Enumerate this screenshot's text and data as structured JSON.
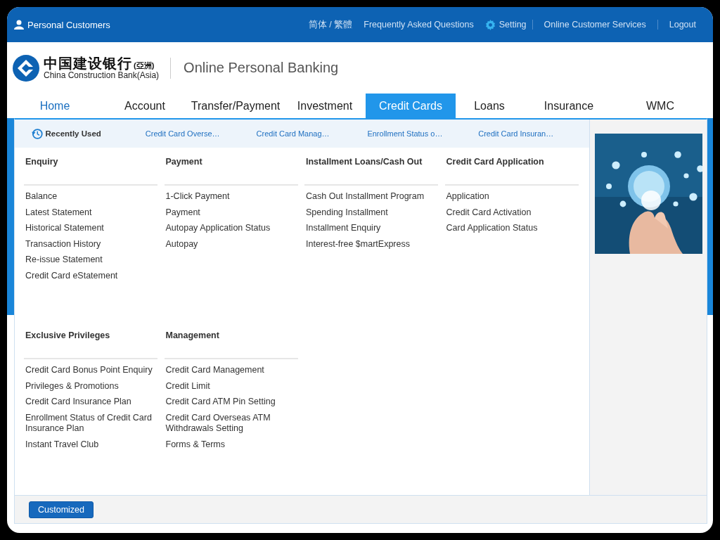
{
  "top_bar": {
    "section": "Personal Customers",
    "links": [
      {
        "label": "简体 / 繁體",
        "kind": "plain"
      },
      {
        "label": "Frequently Asked Questions",
        "kind": "plain"
      },
      {
        "label": "Setting",
        "kind": "settings"
      },
      {
        "label": "Online Customer Services",
        "kind": "plain"
      },
      {
        "label": "Logout",
        "kind": "plain"
      }
    ]
  },
  "header": {
    "logo_chinese": "中国建设银行",
    "logo_suffix": "(亞洲)",
    "logo_english": "China Construction Bank(Asia)",
    "title": "Online Personal Banking"
  },
  "nav": [
    {
      "label": "Home",
      "selected": false,
      "current": true
    },
    {
      "label": "Account",
      "selected": false,
      "current": false
    },
    {
      "label": "Transfer/Payment",
      "selected": false,
      "current": false
    },
    {
      "label": "Investment",
      "selected": false,
      "current": false
    },
    {
      "label": "Credit Cards",
      "selected": true,
      "current": false
    },
    {
      "label": "Loans",
      "selected": false,
      "current": false
    },
    {
      "label": "Insurance",
      "selected": false,
      "current": false
    },
    {
      "label": "WMC",
      "selected": false,
      "current": false
    }
  ],
  "menu": {
    "recently_used": {
      "label": "Recently Used",
      "items": [
        "Credit Card Overse…",
        "Credit Card Manag…",
        "Enrollment Status o…",
        "Credit Card Insuran…"
      ]
    },
    "rows": [
      {
        "columns": [
          {
            "heading": "Enquiry",
            "items": [
              "Balance",
              "Latest Statement",
              "Historical Statement",
              "Transaction History",
              "Re-issue Statement",
              "Credit Card eStatement"
            ]
          },
          {
            "heading": "Payment",
            "items": [
              "1-Click Payment",
              "Payment",
              "Autopay Application Status",
              "Autopay"
            ]
          },
          {
            "heading": "Installment Loans/Cash Out",
            "items": [
              "Cash Out Installment Program",
              "Spending Installment",
              "Installment Enquiry",
              "Interest-free $martExpress"
            ]
          },
          {
            "heading": "Credit Card Application",
            "items": [
              "Application",
              "Credit Card Activation",
              "Card Application Status"
            ]
          }
        ]
      },
      {
        "columns": [
          {
            "heading": "Exclusive Privileges",
            "items": [
              "Credit Card Bonus Point Enquiry",
              "Privileges & Promotions",
              "Credit Card Insurance Plan",
              "Enrollment Status of Credit Card Insurance Plan",
              "Instant Travel Club"
            ]
          },
          {
            "heading": "Management",
            "items": [
              "Credit Card Management",
              "Credit Limit",
              "Credit Card ATM Pin Setting",
              "Credit Card Overseas ATM Withdrawals Setting",
              "Forms & Terms"
            ]
          }
        ]
      }
    ],
    "footer_button": "Customized"
  }
}
